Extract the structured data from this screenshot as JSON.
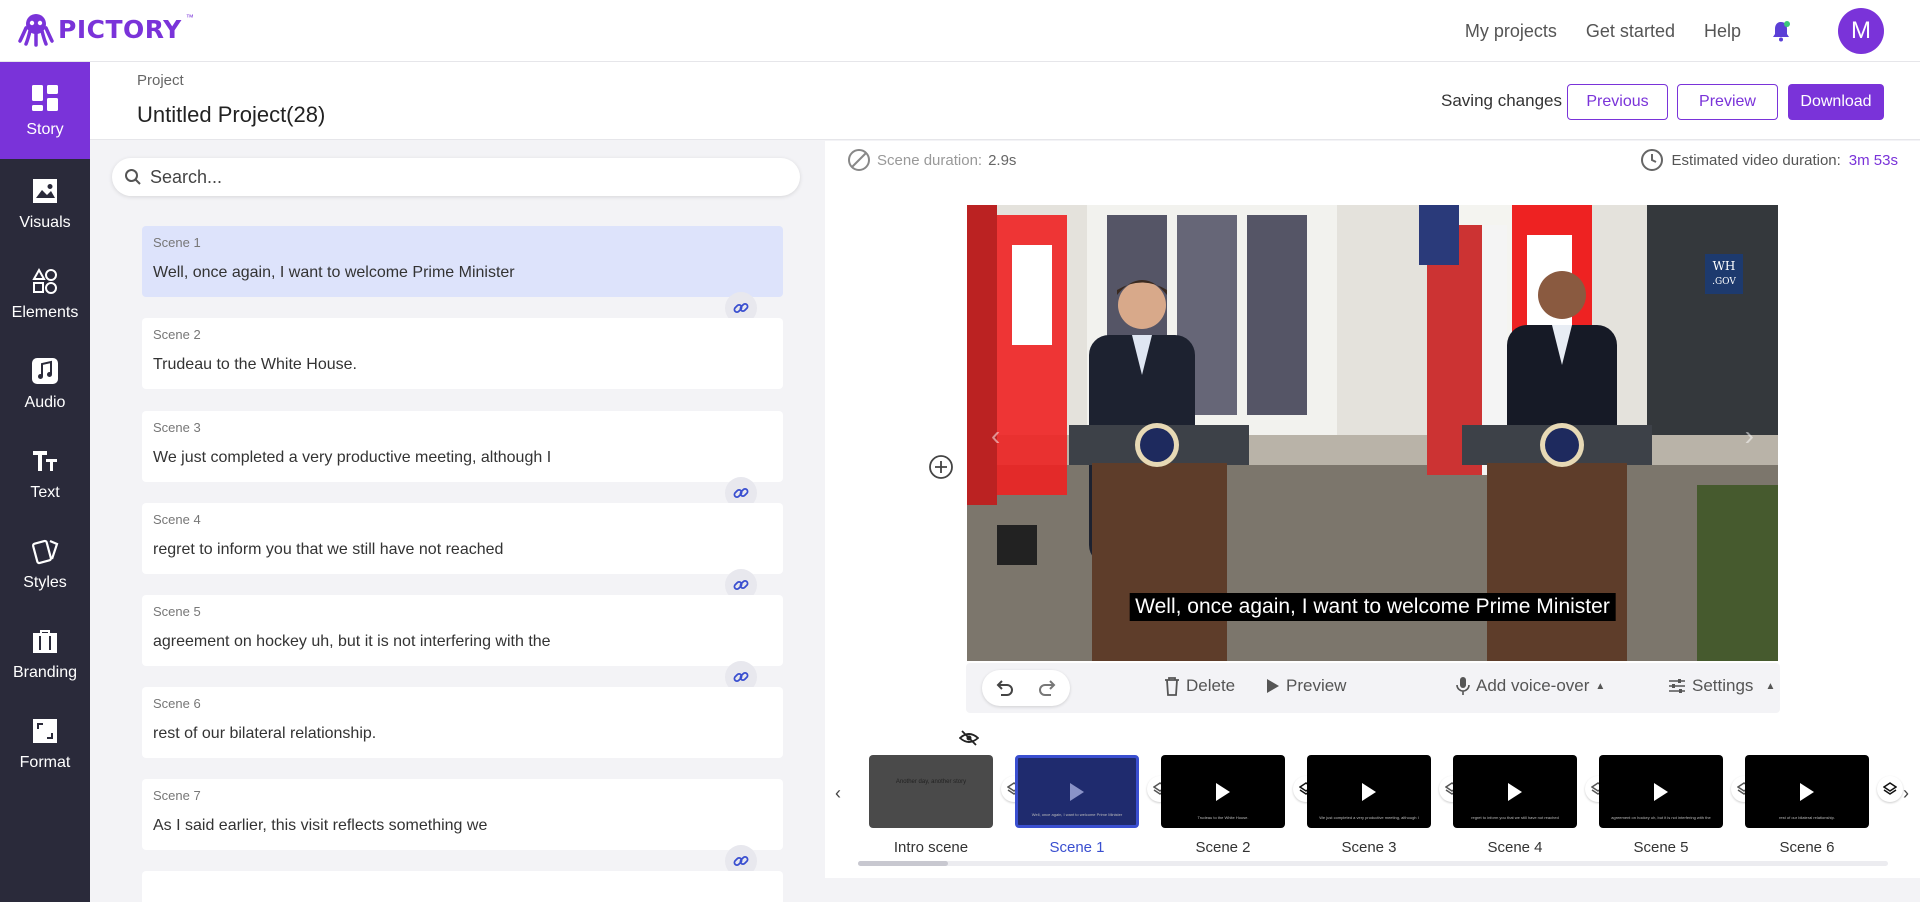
{
  "app": {
    "brand": "PICTORY",
    "tm": "™"
  },
  "topnav": {
    "my_projects": "My projects",
    "get_started": "Get started",
    "help": "Help",
    "avatar_initial": "M"
  },
  "sidebar": {
    "items": [
      {
        "label": "Story",
        "icon": "story-icon",
        "active": true
      },
      {
        "label": "Visuals",
        "icon": "image-icon"
      },
      {
        "label": "Elements",
        "icon": "shapes-icon"
      },
      {
        "label": "Audio",
        "icon": "music-icon"
      },
      {
        "label": "Text",
        "icon": "text-icon"
      },
      {
        "label": "Styles",
        "icon": "cards-icon"
      },
      {
        "label": "Branding",
        "icon": "briefcase-icon"
      },
      {
        "label": "Format",
        "icon": "aspect-icon"
      }
    ]
  },
  "project": {
    "label": "Project",
    "title": "Untitled Project(28)",
    "saving": "Saving changes",
    "previous": "Previous",
    "preview": "Preview",
    "download": "Download"
  },
  "search": {
    "placeholder": "Search..."
  },
  "scenes": [
    {
      "label": "Scene 1",
      "text": "Well, once again, I want to welcome Prime Minister"
    },
    {
      "label": "Scene 2",
      "text": "Trudeau to the White House."
    },
    {
      "label": "Scene 3",
      "text": "We just completed a very productive meeting, although I"
    },
    {
      "label": "Scene 4",
      "text": "regret to inform you that we still have not reached"
    },
    {
      "label": "Scene 5",
      "text": "agreement on hockey uh, but it is not interfering with the"
    },
    {
      "label": "Scene 6",
      "text": "rest of our bilateral relationship."
    },
    {
      "label": "Scene 7",
      "text": "As I said earlier, this visit reflects something we"
    }
  ],
  "editor": {
    "scene_duration_label": "Scene duration:",
    "scene_duration": "2.9s",
    "est_label": "Estimated video duration:",
    "est_value": "3m 53s",
    "subtitle": "Well, once again, I want to welcome Prime Minister",
    "watermark_top": "WH",
    "watermark_bottom": ".GOV",
    "delete": "Delete",
    "preview": "Preview",
    "voiceover": "Add voice-over",
    "settings": "Settings"
  },
  "timeline": [
    {
      "caption": "Intro scene",
      "mini": "Another day, another story"
    },
    {
      "caption": "Scene 1",
      "mini": "Well, once again, I want to welcome Prime Minister"
    },
    {
      "caption": "Scene 2",
      "mini": "Trudeau to the White House."
    },
    {
      "caption": "Scene 3",
      "mini": "We just completed a very productive meeting, although I"
    },
    {
      "caption": "Scene 4",
      "mini": "regret to inform you that we still have not reached"
    },
    {
      "caption": "Scene 5",
      "mini": "agreement on hockey uh, but it is not interfering with the"
    },
    {
      "caption": "Scene 6",
      "mini": "rest of our bilateral relationship."
    }
  ],
  "colors": {
    "accent": "#7a33d9",
    "sidebar": "#2a2a3a",
    "selected_scene": "#dde3fb",
    "selected_thumb": "#3a4fd0"
  }
}
